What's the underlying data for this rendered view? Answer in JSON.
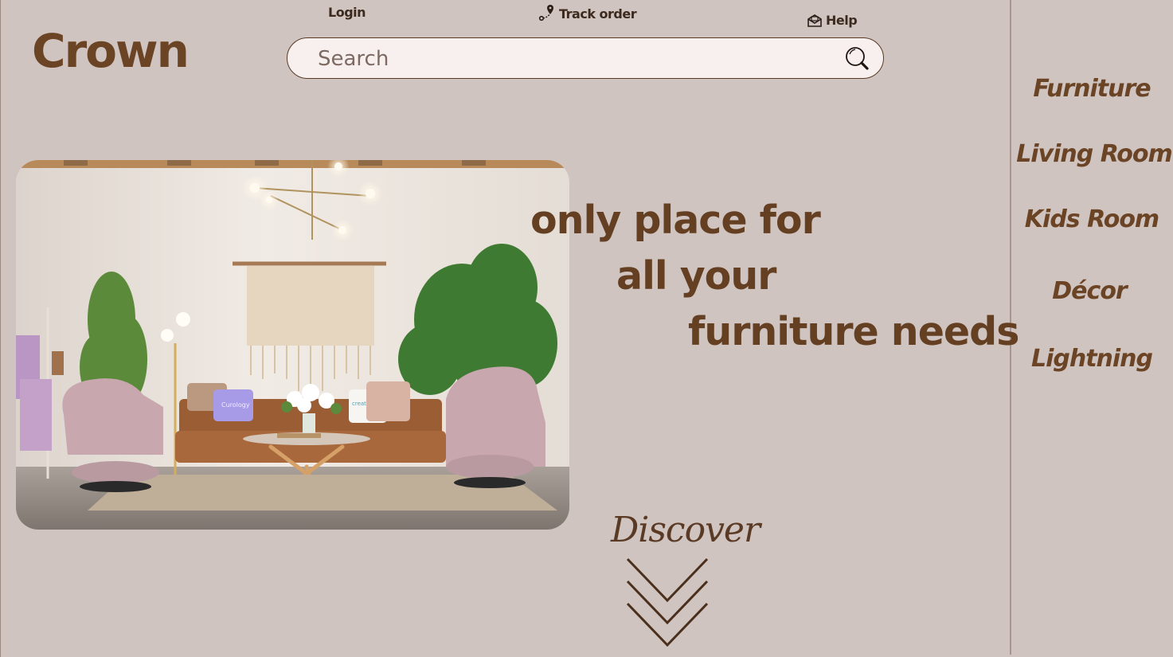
{
  "brand": {
    "name": "Crown"
  },
  "top_nav": {
    "login": "Login",
    "track_order": "Track order",
    "help": "Help"
  },
  "search": {
    "placeholder": "Search"
  },
  "hero": {
    "line1": "only place for",
    "line2": "all your",
    "line3": "furniture needs"
  },
  "discover": {
    "label": "Discover"
  },
  "categories": [
    {
      "label": "Furniture"
    },
    {
      "label": "Living Room"
    },
    {
      "label": "Kids Room"
    },
    {
      "label": "Décor"
    },
    {
      "label": "Lightning"
    }
  ],
  "photo": {
    "pillow_left": "Curology",
    "pillow_right": "creativeskin",
    "towel": "Curology"
  },
  "colors": {
    "background": "#cfc4bf",
    "brand_brown": "#6b4325",
    "search_bg": "#f8f0ee"
  }
}
